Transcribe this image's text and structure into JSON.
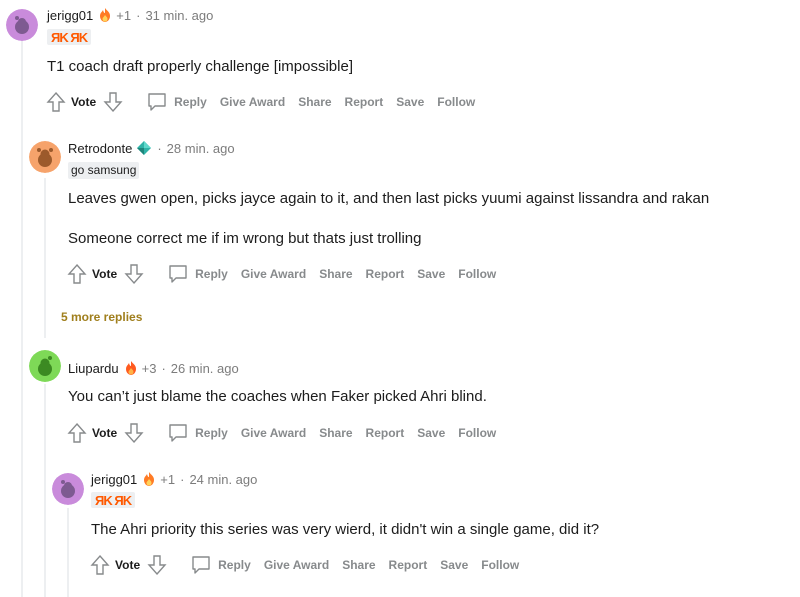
{
  "comments": [
    {
      "username": "jerigg01",
      "award_count": "+1",
      "separator": "·",
      "time": "31 min. ago",
      "flair_type": "fnatic-logo",
      "flair_text": "ЯK ЯK",
      "avatar_color": "#c98bdb",
      "body": [
        "T1 coach draft properly challenge [impossible]"
      ]
    },
    {
      "username": "Retrodonte",
      "award_count": "",
      "separator": "·",
      "time": "28 min. ago",
      "flair_type": "text",
      "flair_text": "go samsung",
      "avatar_color": "#f6a36b",
      "body": [
        "Leaves gwen open, picks jayce again to it, and then last picks yuumi against lissandra and rakan",
        "Someone correct me if im wrong but thats just trolling"
      ]
    },
    {
      "username": "Liupardu",
      "award_count": "+3",
      "separator": "·",
      "time": "26 min. ago",
      "flair_type": "none",
      "flair_text": "",
      "avatar_color": "#7ed957",
      "body": [
        "You can’t just blame the coaches when Faker picked Ahri blind."
      ]
    },
    {
      "username": "jerigg01",
      "award_count": "+1",
      "separator": "·",
      "time": "24 min. ago",
      "flair_type": "fnatic-logo",
      "flair_text": "ЯK ЯK",
      "avatar_color": "#c98bdb",
      "body": [
        "The Ahri priority this series was very wierd, it didn't win a single game, did it?"
      ]
    }
  ],
  "actions": {
    "vote": "Vote",
    "reply": "Reply",
    "give_award": "Give Award",
    "share": "Share",
    "report": "Report",
    "save": "Save",
    "follow": "Follow"
  },
  "more_replies": "5 more replies",
  "icons": {
    "upvote": "upvote-arrow-icon",
    "downvote": "downvote-arrow-icon",
    "reply": "comment-bubble-icon",
    "award_fire": "fire-award-icon",
    "award_diamond": "diamond-award-icon"
  },
  "colors": {
    "muted": "#7c7c7c",
    "action_gray": "#878a8c",
    "more_replies": "#a07f1d",
    "thread_line": "#edeff1",
    "fnatic_orange": "#ff5900"
  }
}
